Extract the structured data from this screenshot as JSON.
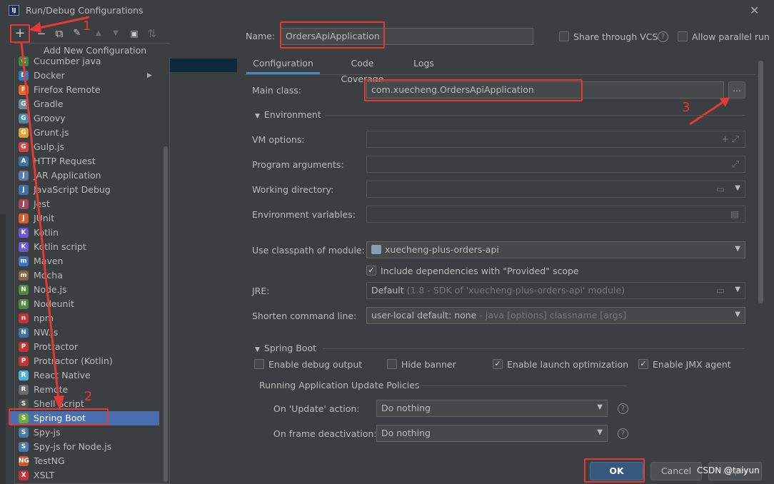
{
  "window": {
    "title": "Run/Debug Configurations",
    "app_icon_text": "IJ"
  },
  "toolbar": {
    "add": "+",
    "remove": "−",
    "copy": "⧉",
    "edit": "🔧",
    "up": "▲",
    "down": "▼",
    "folder": "📁",
    "sort": "⇅"
  },
  "popup": {
    "header": "Add New Configuration",
    "items": [
      {
        "label": "Cucumber java",
        "color": "#3d8b3d",
        "glyph": "C"
      },
      {
        "label": "Docker",
        "color": "#2b7dc7",
        "glyph": "D",
        "arrow": "▶"
      },
      {
        "label": "Firefox Remote",
        "color": "#e8662a",
        "glyph": "F"
      },
      {
        "label": "Gradle",
        "color": "#6b8a9a",
        "glyph": "G"
      },
      {
        "label": "Groovy",
        "color": "#4a8bab",
        "glyph": "G"
      },
      {
        "label": "Grunt.js",
        "color": "#e0a030",
        "glyph": "G"
      },
      {
        "label": "Gulp.js",
        "color": "#cf4646",
        "glyph": "G"
      },
      {
        "label": "HTTP Request",
        "color": "#3f73a8",
        "glyph": "A"
      },
      {
        "label": "JAR Application",
        "color": "#5a7aa8",
        "glyph": "J"
      },
      {
        "label": "JavaScript Debug",
        "color": "#3f73a8",
        "glyph": "J"
      },
      {
        "label": "Jest",
        "color": "#a0485c",
        "glyph": "J"
      },
      {
        "label": "JUnit",
        "color": "#d65e2e",
        "glyph": "J"
      },
      {
        "label": "Kotlin",
        "color": "#6d57d6",
        "glyph": "K"
      },
      {
        "label": "Kotlin script",
        "color": "#6d57d6",
        "glyph": "K"
      },
      {
        "label": "Maven",
        "color": "#3f73c8",
        "glyph": "m"
      },
      {
        "label": "Mocha",
        "color": "#8a6543",
        "glyph": "m"
      },
      {
        "label": "Node.js",
        "color": "#4e8c3a",
        "glyph": "N"
      },
      {
        "label": "Nodeunit",
        "color": "#4e8c3a",
        "glyph": "N"
      },
      {
        "label": "npm",
        "color": "#c53333",
        "glyph": "n"
      },
      {
        "label": "NW.js",
        "color": "#3f73a8",
        "glyph": "N"
      },
      {
        "label": "Protractor",
        "color": "#c53333",
        "glyph": "P"
      },
      {
        "label": "Protractor (Kotlin)",
        "color": "#c53333",
        "glyph": "P"
      },
      {
        "label": "React Native",
        "color": "#4fb3d9",
        "glyph": "R"
      },
      {
        "label": "Remote",
        "color": "#6b6b6b",
        "glyph": "R"
      },
      {
        "label": "Shell Script",
        "color": "#555555",
        "glyph": "S"
      },
      {
        "label": "Spring Boot",
        "color": "#6aab3a",
        "glyph": "S"
      },
      {
        "label": "Spy-js",
        "color": "#4a7aa8",
        "glyph": "S"
      },
      {
        "label": "Spy-js for Node.js",
        "color": "#4a7aa8",
        "glyph": "S"
      },
      {
        "label": "TestNG",
        "color": "#c85a2a",
        "glyph": "NG"
      },
      {
        "label": "XSLT",
        "color": "#c53333",
        "glyph": "X"
      }
    ],
    "selected_index": 25
  },
  "name": {
    "label": "Name:",
    "value": "OrdersApiApplication"
  },
  "share_vcs": {
    "label": "Share through VCS",
    "checked": false
  },
  "allow_parallel": {
    "label": "Allow parallel run",
    "checked": false
  },
  "tabs": [
    {
      "label": "Configuration"
    },
    {
      "label": "Code Coverage"
    },
    {
      "label": "Logs"
    }
  ],
  "main_class": {
    "label": "Main class:",
    "value": "com.xuecheng.OrdersApiApplication",
    "browse": "..."
  },
  "environment": {
    "section_label": "Environment",
    "vm_options": "VM options:",
    "program_args": "Program arguments:",
    "working_dir": "Working directory:",
    "env_vars": "Environment variables:"
  },
  "classpath": {
    "label": "Use classpath of module:",
    "value": "xuecheng-plus-orders-api"
  },
  "include_deps": {
    "label": "Include dependencies with \"Provided\" scope",
    "checked": true
  },
  "jre": {
    "label": "JRE:",
    "value": "Default",
    "hint": "(1.8 - SDK of 'xuecheng-plus-orders-api' module)"
  },
  "shorten": {
    "label": "Shorten command line:",
    "value": "user-local default: none",
    "hint": "- java [options] classname [args]"
  },
  "spring_boot": {
    "section_label": "Spring Boot",
    "enable_debug": {
      "label": "Enable debug output",
      "checked": false
    },
    "hide_banner": {
      "label": "Hide banner",
      "checked": false
    },
    "launch_opt": {
      "label": "Enable launch optimization",
      "checked": true
    },
    "jmx": {
      "label": "Enable JMX agent",
      "checked": true
    },
    "policies_label": "Running Application Update Policies",
    "on_update": {
      "label": "On 'Update' action:",
      "value": "Do nothing"
    },
    "on_frame": {
      "label": "On frame deactivation:",
      "value": "Do nothing"
    }
  },
  "buttons": {
    "ok": "OK",
    "cancel": "Cancel",
    "apply": "Apply"
  },
  "annotations": {
    "n1": "1",
    "n2": "2",
    "n3": "3"
  },
  "watermark": "CSDN @taiyun"
}
